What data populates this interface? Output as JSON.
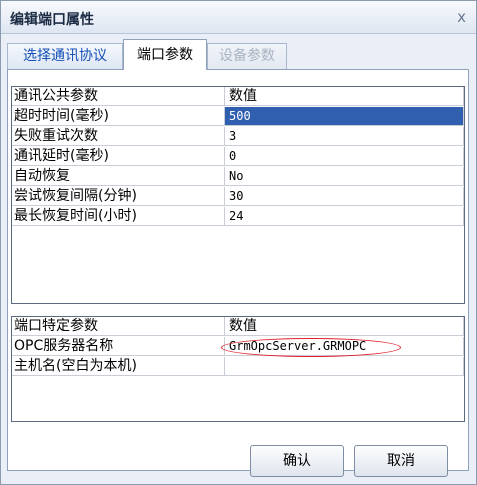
{
  "window": {
    "title": "编辑端口属性",
    "close_glyph": "x"
  },
  "tabs": [
    {
      "label": "选择通讯协议",
      "state": "normal"
    },
    {
      "label": "端口参数",
      "state": "selected"
    },
    {
      "label": "设备参数",
      "state": "disabled"
    }
  ],
  "common_params": {
    "header": {
      "name": "通讯公共参数",
      "value": "数值"
    },
    "rows": [
      {
        "name": "超时时间(毫秒)",
        "value": "500"
      },
      {
        "name": "失败重试次数",
        "value": "3"
      },
      {
        "name": "通讯延时(毫秒)",
        "value": "0"
      },
      {
        "name": "自动恢复",
        "value": "No"
      },
      {
        "name": "尝试恢复间隔(分钟)",
        "value": "30"
      },
      {
        "name": "最长恢复时间(小时)",
        "value": "24"
      }
    ]
  },
  "specific_params": {
    "header": {
      "name": "端口特定参数",
      "value": "数值"
    },
    "rows": [
      {
        "name": "OPC服务器名称",
        "value": "GrmOpcServer.GRMOPC"
      },
      {
        "name": "主机名(空白为本机)",
        "value": ""
      }
    ]
  },
  "buttons": {
    "ok": "确认",
    "cancel": "取消"
  },
  "colors": {
    "selection": "#2f5fae",
    "highlight_ellipse": "#e0202a",
    "tab_link": "#1550b8"
  }
}
